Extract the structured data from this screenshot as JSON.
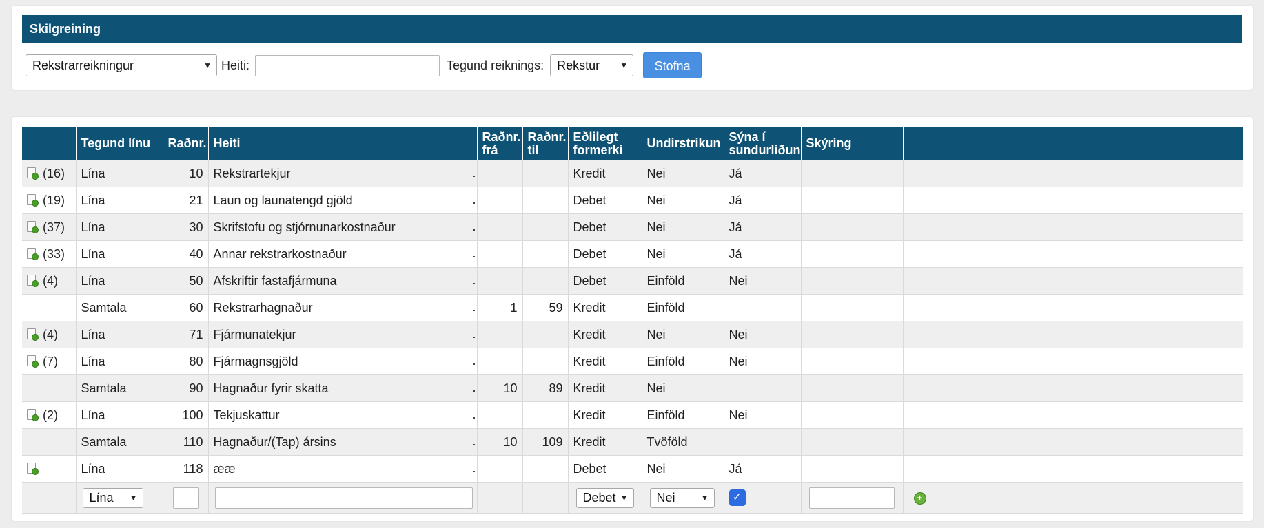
{
  "header": {
    "title": "Skilgreining",
    "report_select": "Rekstrarreikningur",
    "name_label": "Heiti:",
    "name_value": "",
    "account_type_label": "Tegund reiknings:",
    "account_type_select": "Rekstur",
    "create_button": "Stofna"
  },
  "table": {
    "columns": [
      "",
      "Tegund línu",
      "Raðnr.",
      "Heiti",
      "Raðnr. frá",
      "Raðnr. til",
      "Eðlilegt formerki",
      "Undirstrikun",
      "Sýna í sundurliðun",
      "Skýring",
      ""
    ],
    "col_headers": {
      "line_type": "Tegund línu",
      "seq": "Raðnr.",
      "name": "Heiti",
      "seq_from_1": "Raðnr.",
      "seq_from_2": "frá",
      "seq_to_1": "Raðnr.",
      "seq_to_2": "til",
      "sign_1": "Eðlilegt",
      "sign_2": "formerki",
      "underline": "Undirstrikun",
      "show_1": "Sýna í",
      "show_2": "sundurliðun",
      "note": "Skýring"
    },
    "rows": [
      {
        "icon": true,
        "count": "(16)",
        "type": "Lína",
        "seq": "10",
        "name": "Rekstrartekjur",
        "dot": ".",
        "from": "",
        "to": "",
        "sign": "Kredit",
        "underline": "Nei",
        "show": "Já",
        "note": ""
      },
      {
        "icon": true,
        "count": "(19)",
        "type": "Lína",
        "seq": "21",
        "name": "Laun og launatengd gjöld",
        "dot": ".",
        "from": "",
        "to": "",
        "sign": "Debet",
        "underline": "Nei",
        "show": "Já",
        "note": ""
      },
      {
        "icon": true,
        "count": "(37)",
        "type": "Lína",
        "seq": "30",
        "name": "Skrifstofu og stjórnunarkostnaður",
        "dot": ".",
        "from": "",
        "to": "",
        "sign": "Debet",
        "underline": "Nei",
        "show": "Já",
        "note": ""
      },
      {
        "icon": true,
        "count": "(33)",
        "type": "Lína",
        "seq": "40",
        "name": "Annar rekstrarkostnaður",
        "dot": ".",
        "from": "",
        "to": "",
        "sign": "Debet",
        "underline": "Nei",
        "show": "Já",
        "note": ""
      },
      {
        "icon": true,
        "count": "(4)",
        "type": "Lína",
        "seq": "50",
        "name": "Afskriftir fastafjármuna",
        "dot": ".",
        "from": "",
        "to": "",
        "sign": "Debet",
        "underline": "Einföld",
        "show": "Nei",
        "note": ""
      },
      {
        "icon": false,
        "count": "",
        "type": "Samtala",
        "seq": "60",
        "name": "Rekstrarhagnaður",
        "dot": ".",
        "from": "1",
        "to": "59",
        "sign": "Kredit",
        "underline": "Einföld",
        "show": "",
        "note": ""
      },
      {
        "icon": true,
        "count": "(4)",
        "type": "Lína",
        "seq": "71",
        "name": "Fjármunatekjur",
        "dot": ".",
        "from": "",
        "to": "",
        "sign": "Kredit",
        "underline": "Nei",
        "show": "Nei",
        "note": ""
      },
      {
        "icon": true,
        "count": "(7)",
        "type": "Lína",
        "seq": "80",
        "name": "Fjármagnsgjöld",
        "dot": ".",
        "from": "",
        "to": "",
        "sign": "Kredit",
        "underline": "Einföld",
        "show": "Nei",
        "note": ""
      },
      {
        "icon": false,
        "count": "",
        "type": "Samtala",
        "seq": "90",
        "name": "Hagnaður fyrir skatta",
        "dot": ".",
        "from": "10",
        "to": "89",
        "sign": "Kredit",
        "underline": "Nei",
        "show": "",
        "note": ""
      },
      {
        "icon": true,
        "count": "(2)",
        "type": "Lína",
        "seq": "100",
        "name": "Tekjuskattur",
        "dot": ".",
        "from": "",
        "to": "",
        "sign": "Kredit",
        "underline": "Einföld",
        "show": "Nei",
        "note": ""
      },
      {
        "icon": false,
        "count": "",
        "type": "Samtala",
        "seq": "110",
        "name": "Hagnaður/(Tap) ársins",
        "dot": ".",
        "from": "10",
        "to": "109",
        "sign": "Kredit",
        "underline": "Tvöföld",
        "show": "",
        "note": ""
      },
      {
        "icon": true,
        "count": "",
        "type": "Lína",
        "seq": "118",
        "name": "ææ",
        "dot": ".",
        "from": "",
        "to": "",
        "sign": "Debet",
        "underline": "Nei",
        "show": "Já",
        "note": ""
      }
    ],
    "new_row": {
      "type_select": "Lína",
      "seq_value": "",
      "name_value": "",
      "sign_select": "Debet",
      "underline_select": "Nei",
      "show_checked": true,
      "note_value": ""
    }
  },
  "colors": {
    "header_bg": "#0e5275",
    "button_bg": "#4a90e2",
    "checkbox": "#2d6be0",
    "add_icon": "#66b23a"
  },
  "icons": {
    "row_icon": "document-add-icon",
    "add_row": "plus-circle-icon",
    "check": "checkmark-icon",
    "dropdown": "chevron-down-icon"
  }
}
